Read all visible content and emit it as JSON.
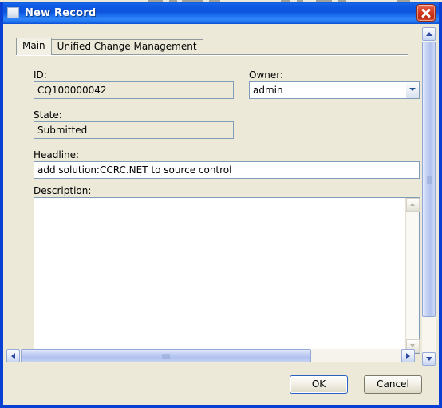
{
  "window": {
    "title": "New Record",
    "icon": "window-icon",
    "close_label": "Close",
    "frame_color": "#0a3fd4",
    "titlebar_color": "#0d53dd",
    "client_color": "#ece9d8"
  },
  "tabs": [
    {
      "label": "Main",
      "active": true
    },
    {
      "label": "Unified Change Management",
      "active": false
    }
  ],
  "form": {
    "id": {
      "label": "ID:",
      "value": "CQ100000042",
      "readonly": true
    },
    "owner": {
      "label": "Owner:",
      "value": "admin",
      "arrow_icon": "chevron-down-icon"
    },
    "state": {
      "label": "State:",
      "value": "Submitted",
      "readonly": true
    },
    "headline": {
      "label": "Headline:",
      "value": "add solution:CCRC.NET to source control",
      "placeholder": ""
    },
    "description": {
      "label": "Description:",
      "value": "",
      "placeholder": ""
    }
  },
  "scrollbars": {
    "horizontal": {
      "left_icon": "arrow-left-icon",
      "right_icon": "arrow-right-icon",
      "thumb_ratio": 0.76
    },
    "vertical": {
      "up_icon": "arrow-up-icon",
      "down_icon": "arrow-down-icon",
      "thumb_ratio": 0.88
    },
    "description_pane": {
      "up_icon": "arrow-up-icon",
      "down_icon": "arrow-down-icon"
    }
  },
  "buttons": {
    "ok": "OK",
    "cancel": "Cancel"
  }
}
